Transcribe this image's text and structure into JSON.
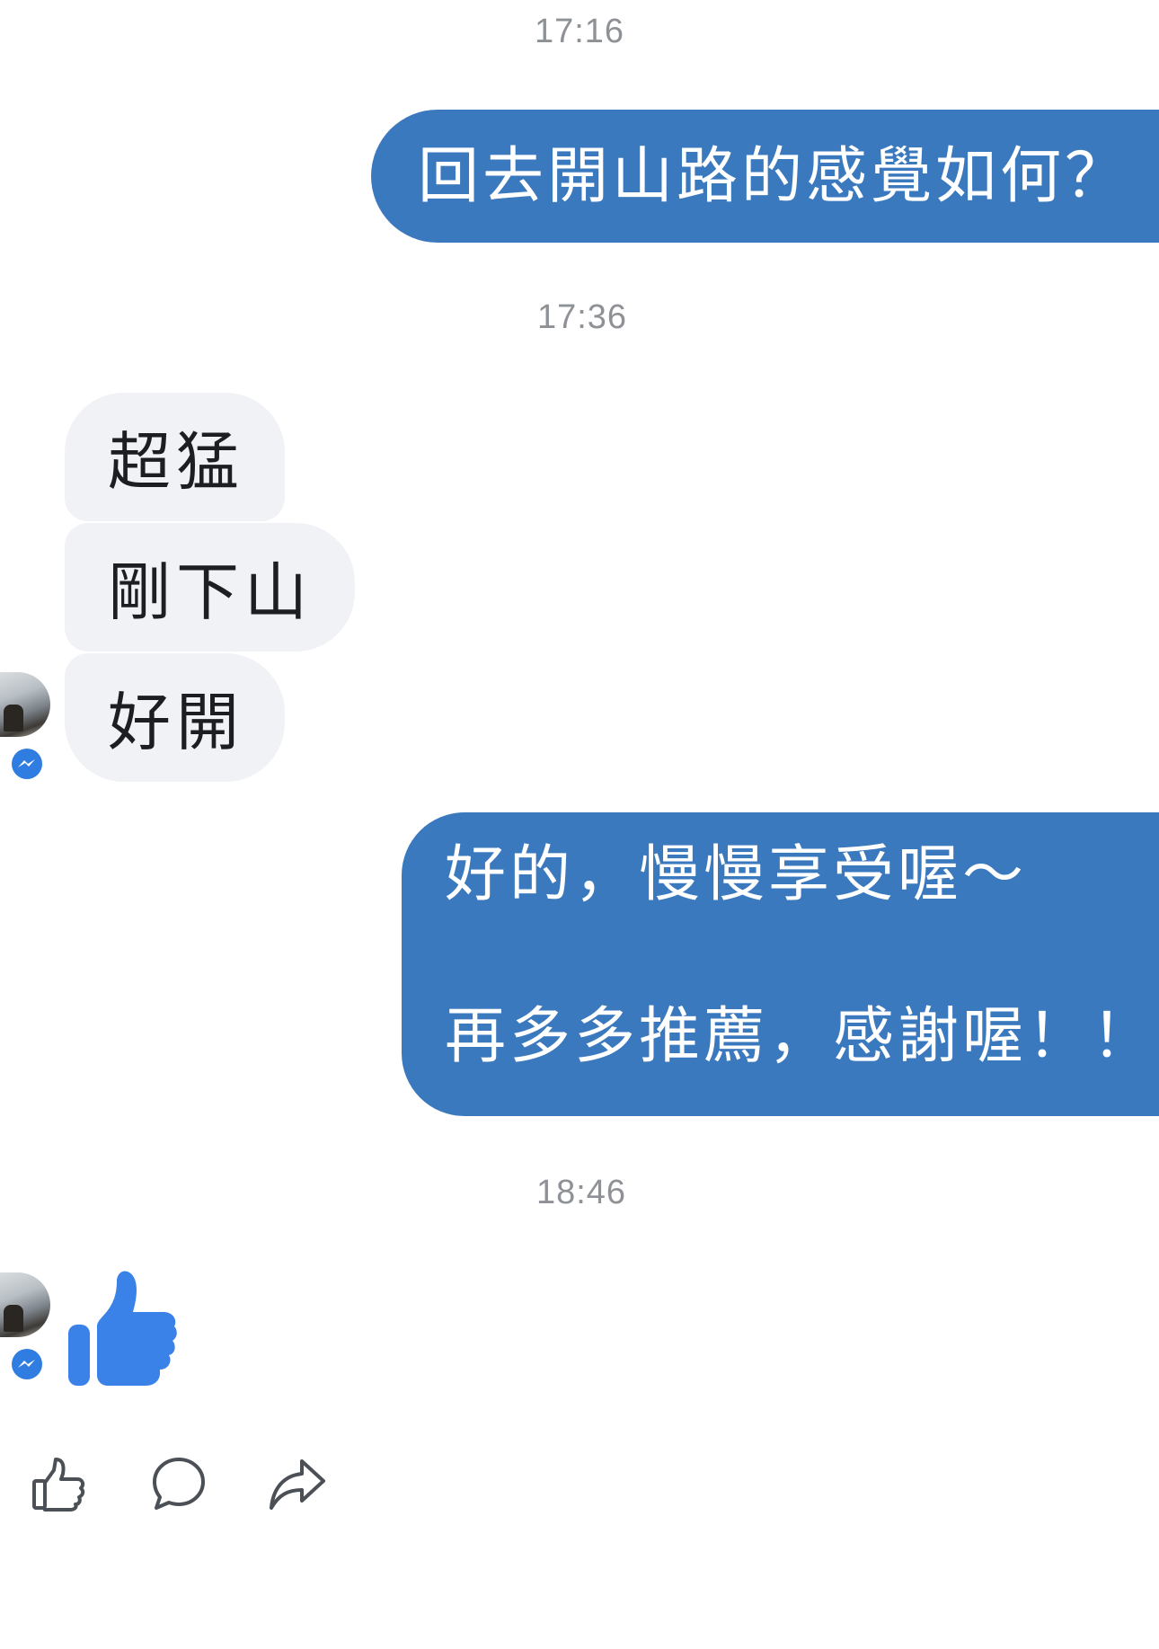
{
  "timestamps": {
    "t1": "17:16",
    "t2": "17:36",
    "t3": "18:46"
  },
  "messages": {
    "out1": "回去開山路的感覺如何？",
    "in1": "超猛",
    "in2": "剛下山",
    "in3": "好開",
    "out2_line1": "好的，慢慢享受喔～",
    "out2_line2": "再多多推薦，感謝喔！！"
  },
  "icons": {
    "like_reaction": "thumbs-up-icon",
    "messenger_badge": "messenger-icon",
    "actions": [
      "like-icon",
      "comment-icon",
      "share-icon"
    ]
  },
  "colors": {
    "outgoing_bubble": "#3b79bf",
    "incoming_bubble": "#f1f2f6",
    "like_blue": "#3b82e8",
    "timestamp": "#8e9196"
  }
}
